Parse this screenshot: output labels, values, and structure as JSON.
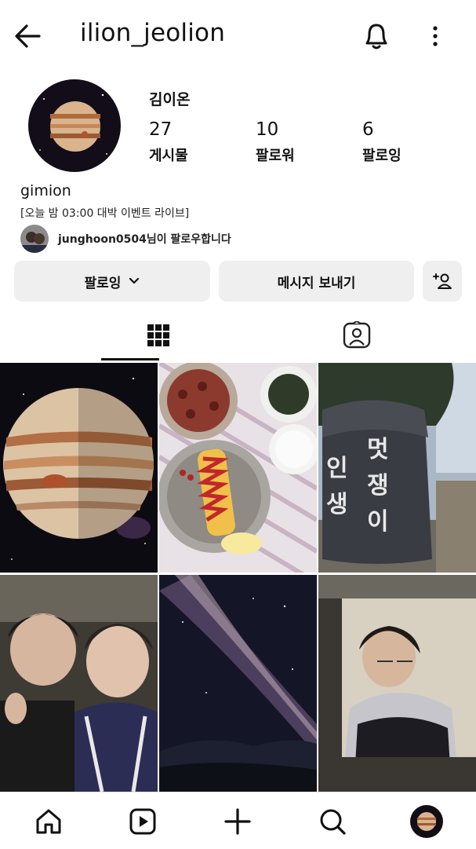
{
  "header": {
    "username": "ilion_jeolion",
    "icons": {
      "back": "back-arrow-icon",
      "bell": "bell-icon",
      "more": "more-vertical-icon"
    }
  },
  "profile": {
    "display_name": "김이온",
    "stats": [
      {
        "value": "27",
        "label": "게시물"
      },
      {
        "value": "10",
        "label": "팔로워"
      },
      {
        "value": "6",
        "label": "팔로잉"
      }
    ],
    "handle": "gimion",
    "bio": "[오늘 밤 03:00 대박 이벤트 라이브]",
    "followed_by_text": "junghoon0504님이 팔로우합니다"
  },
  "actions": {
    "following_label": "팔로잉",
    "message_label": "메시지 보내기",
    "add_person_icon": "add-person-icon"
  },
  "tabs": [
    {
      "icon": "grid-icon",
      "selected": true
    },
    {
      "icon": "tagged-person-icon",
      "selected": false
    }
  ],
  "grid_posts": [
    {
      "subject": "jupiter-planet"
    },
    {
      "subject": "food-tray-omurice"
    },
    {
      "subject": "stone-sign"
    },
    {
      "subject": "two-boys-selfie"
    },
    {
      "subject": "milky-way-night-sky"
    },
    {
      "subject": "boy-studying"
    }
  ],
  "stone_sign_text": [
    "인 생",
    "멋 쟁 이"
  ],
  "bottom_nav": [
    {
      "icon": "home-icon"
    },
    {
      "icon": "reels-icon"
    },
    {
      "icon": "create-plus-icon"
    },
    {
      "icon": "search-icon"
    },
    {
      "icon": "profile-avatar-icon"
    }
  ],
  "colors": {
    "button_bg": "#efefef",
    "text": "#111111"
  }
}
